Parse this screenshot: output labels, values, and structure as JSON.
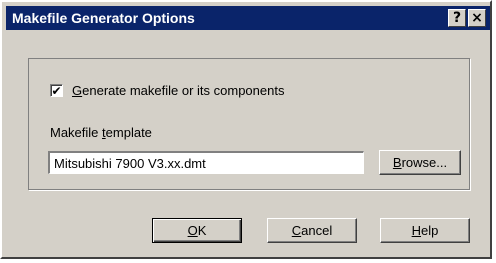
{
  "window": {
    "title": "Makefile Generator Options",
    "help_button": "?",
    "close_button": "×"
  },
  "options": {
    "generate_checkbox": {
      "checked": true,
      "mark": "✔",
      "label_underlined": "G",
      "label_rest": "enerate makefile or its components"
    },
    "template_label_start": "Makefile ",
    "template_label_underlined": "t",
    "template_label_end": "emplate",
    "template_value": "Mitsubishi 7900 V3.xx.dmt",
    "browse_underlined": "B",
    "browse_rest": "rowse..."
  },
  "buttons": {
    "ok_underlined": "O",
    "ok_rest": "K",
    "cancel_underlined": "C",
    "cancel_rest": "ancel",
    "help_underlined": "H",
    "help_rest": "elp"
  }
}
